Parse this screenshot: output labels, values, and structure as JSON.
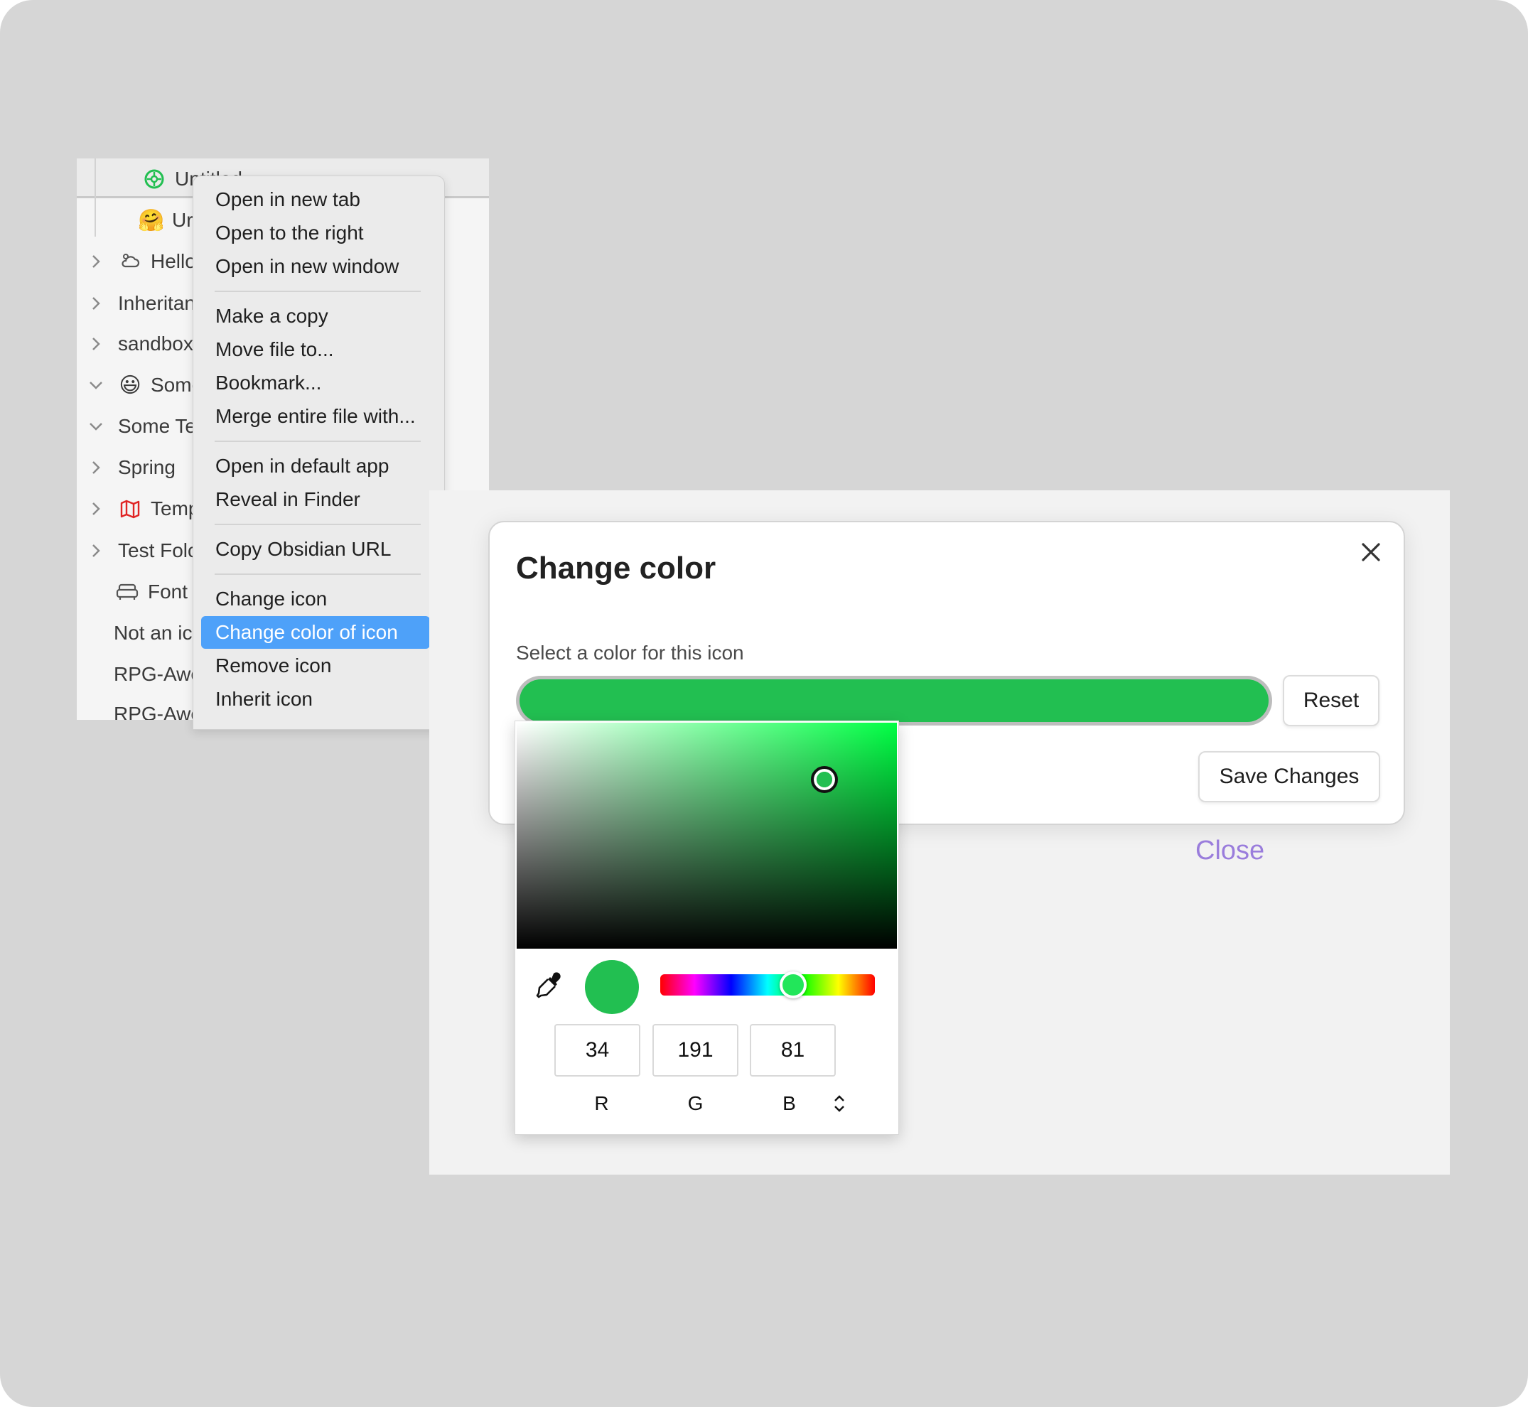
{
  "explorer": {
    "rows": [
      {
        "label": "Untitled",
        "icon": "green-flower-icon",
        "chevron": "none"
      },
      {
        "label": "Ur",
        "icon": "hugging-face-emoji",
        "chevron": "none"
      },
      {
        "label": "Hello",
        "icon": "cloud-sun-icon",
        "chevron": "right"
      },
      {
        "label": "Inheritan",
        "icon": "",
        "chevron": "right"
      },
      {
        "label": "sandbox",
        "icon": "",
        "chevron": "right"
      },
      {
        "label": "Some",
        "icon": "smiley-emoji",
        "chevron": "down"
      },
      {
        "label": "Some Te",
        "icon": "",
        "chevron": "down"
      },
      {
        "label": "Spring",
        "icon": "",
        "chevron": "right"
      },
      {
        "label": "Temp",
        "icon": "map-icon",
        "chevron": "right"
      },
      {
        "label": "Test Folc",
        "icon": "",
        "chevron": "right"
      },
      {
        "label": "Font",
        "icon": "sofa-icon",
        "chevron": "none"
      },
      {
        "label": "Not an ic",
        "icon": "",
        "chevron": "none"
      },
      {
        "label": "RPG-Awe",
        "icon": "",
        "chevron": "none"
      },
      {
        "label": "RPG-Awe",
        "icon": "",
        "chevron": "none"
      }
    ]
  },
  "context_menu": {
    "items": [
      "Open in new tab",
      "Open to the right",
      "Open in new window",
      "Make a copy",
      "Move file to...",
      "Bookmark...",
      "Merge entire file with...",
      "Open in default app",
      "Reveal in Finder",
      "Copy Obsidian URL",
      "Change icon",
      "Change color of icon",
      "Remove icon",
      "Inherit icon"
    ],
    "selected": "Change color of icon"
  },
  "modal": {
    "title": "Change color",
    "label": "Select a color for this icon",
    "reset_label": "Reset",
    "save_label": "Save Changes",
    "close_link": "Close"
  },
  "picker": {
    "color_hex": "#22bf51",
    "hue_fraction": 0.62,
    "saturation_fraction": 0.81,
    "value_fraction": 0.75,
    "rgb": {
      "r": "34",
      "g": "191",
      "b": "81"
    },
    "labels": {
      "r": "R",
      "g": "G",
      "b": "B"
    }
  },
  "colors": {
    "accent_selection": "#4ea1f9",
    "link_purple": "#9a7ddc",
    "icon_green": "#22bf51",
    "map_red": "#e02424"
  }
}
